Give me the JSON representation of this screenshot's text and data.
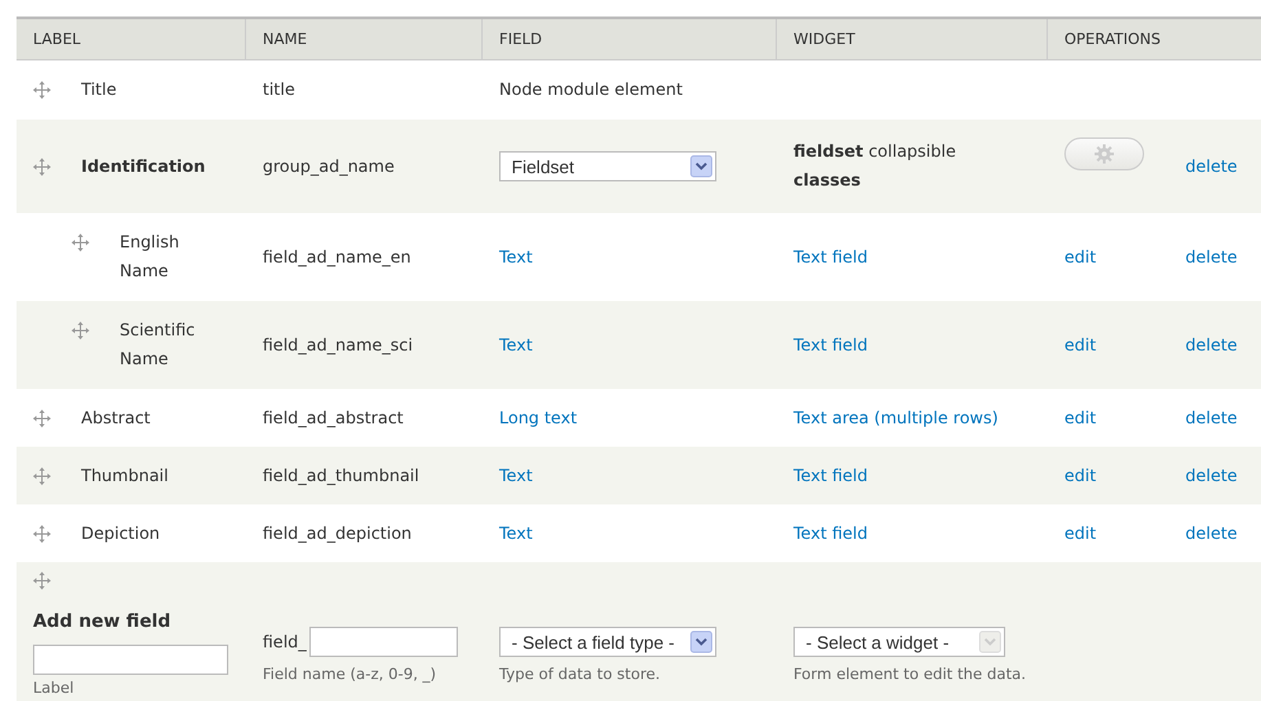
{
  "columns": [
    "LABEL",
    "NAME",
    "FIELD",
    "WIDGET",
    "OPERATIONS"
  ],
  "rows": [
    {
      "kind": "field",
      "label": "Title",
      "name": "title",
      "field": {
        "kind": "text",
        "text": "Node module element"
      }
    },
    {
      "kind": "group",
      "label": "Identification",
      "name": "group_ad_name",
      "field": {
        "kind": "select",
        "value": "Fieldset"
      },
      "widget": {
        "kind": "rich",
        "text": "**fieldset** collapsible **classes**"
      },
      "operations": [
        {
          "kind": "gear"
        },
        {
          "kind": "link",
          "text": "delete"
        }
      ],
      "children": [
        {
          "kind": "field",
          "label": "English Name",
          "name": "field_ad_name_en",
          "field": {
            "kind": "link",
            "text": "Text"
          },
          "widget": {
            "kind": "link",
            "text": "Text field"
          },
          "operations": [
            {
              "kind": "link",
              "text": "edit"
            },
            {
              "kind": "link",
              "text": "delete"
            }
          ]
        },
        {
          "kind": "field",
          "label": "Scientific Name",
          "name": "field_ad_name_sci",
          "field": {
            "kind": "link",
            "text": "Text"
          },
          "widget": {
            "kind": "link",
            "text": "Text field"
          },
          "operations": [
            {
              "kind": "link",
              "text": "edit"
            },
            {
              "kind": "link",
              "text": "delete"
            }
          ]
        }
      ]
    },
    {
      "kind": "field",
      "label": "Abstract",
      "name": "field_ad_abstract",
      "field": {
        "kind": "link",
        "text": "Long text"
      },
      "widget": {
        "kind": "link",
        "text": "Text area (multiple rows)"
      },
      "operations": [
        {
          "kind": "link",
          "text": "edit"
        },
        {
          "kind": "link",
          "text": "delete"
        }
      ]
    },
    {
      "kind": "field",
      "label": "Thumbnail",
      "name": "field_ad_thumbnail",
      "field": {
        "kind": "link",
        "text": "Text"
      },
      "widget": {
        "kind": "link",
        "text": "Text field"
      },
      "operations": [
        {
          "kind": "link",
          "text": "edit"
        },
        {
          "kind": "link",
          "text": "delete"
        }
      ]
    },
    {
      "kind": "field",
      "label": "Depiction",
      "name": "field_ad_depiction",
      "field": {
        "kind": "link",
        "text": "Text"
      },
      "widget": {
        "kind": "link",
        "text": "Text field"
      },
      "operations": [
        {
          "kind": "link",
          "text": "edit"
        },
        {
          "kind": "link",
          "text": "delete"
        }
      ]
    }
  ],
  "add_new": {
    "title": "Add new field",
    "label_hint": "Label",
    "prefix": "field_",
    "name_hint": "Field name (a-z, 0-9, _)",
    "type_select": {
      "value": "- Select a field type -",
      "disabled": false
    },
    "type_hint": "Type of data to store.",
    "widget_select": {
      "value": "- Select a widget -",
      "disabled": true
    },
    "widget_hint": "Form element to edit the data."
  }
}
